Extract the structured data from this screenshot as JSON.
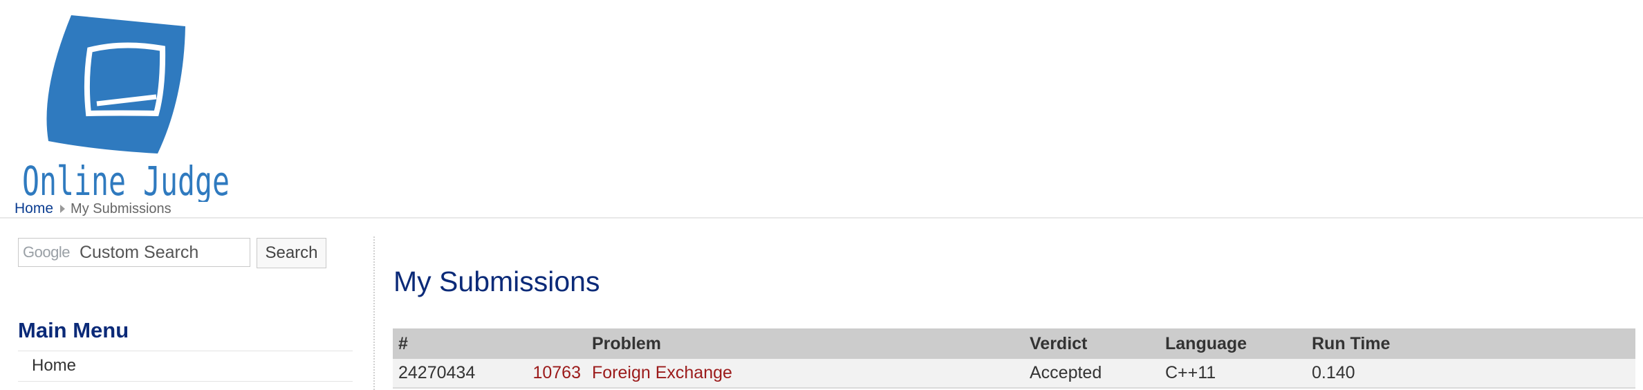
{
  "brand": {
    "logo_text": "Online Judge",
    "color": "#2f7abf"
  },
  "breadcrumb": {
    "home": "Home",
    "current": "My Submissions"
  },
  "search": {
    "google_label": "Google",
    "placeholder": "Custom Search",
    "button_label": "Search"
  },
  "sidebar": {
    "menu_title": "Main Menu",
    "items": [
      {
        "label": "Home"
      }
    ]
  },
  "main": {
    "title": "My Submissions",
    "table": {
      "headers": {
        "id": "#",
        "problem": "Problem",
        "verdict": "Verdict",
        "language": "Language",
        "runtime": "Run Time"
      },
      "rows": [
        {
          "id": "24270434",
          "problem_number": "10763",
          "problem_name": "Foreign Exchange",
          "verdict": "Accepted",
          "language": "C++11",
          "runtime": "0.140"
        }
      ]
    }
  },
  "colors": {
    "accent": "#0b2a78",
    "link": "#9b1a1a",
    "header_row": "#cccccc",
    "row_bg": "#f2f2f2"
  }
}
